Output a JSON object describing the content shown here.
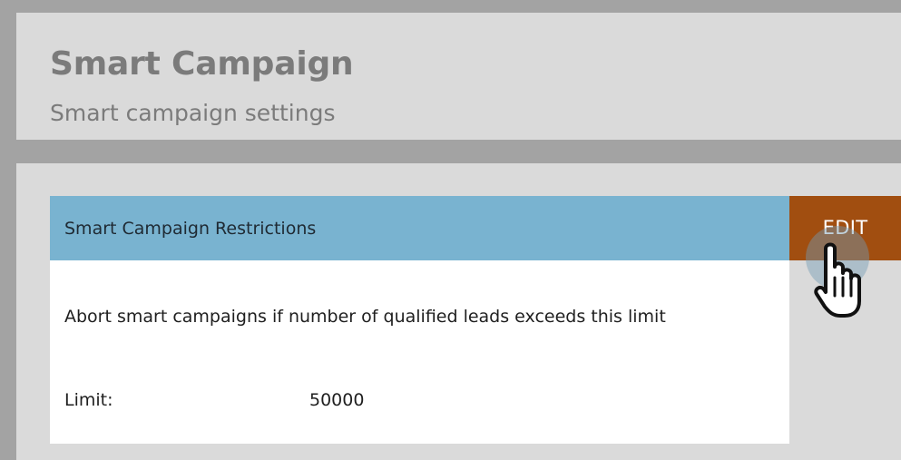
{
  "header": {
    "title": "Smart Campaign",
    "subtitle": "Smart campaign settings"
  },
  "restrictions": {
    "title": "Smart Campaign Restrictions",
    "edit_label": "EDIT",
    "description": "Abort smart campaigns if number of qualified leads exceeds this limit",
    "limit_label": "Limit:",
    "limit_value": "50000"
  },
  "icons": {
    "cursor": "hand-pointer-icon"
  },
  "colors": {
    "header_bar": "#79b3d0",
    "edit_button": "#a14e10",
    "panel_bg": "#dadada"
  }
}
